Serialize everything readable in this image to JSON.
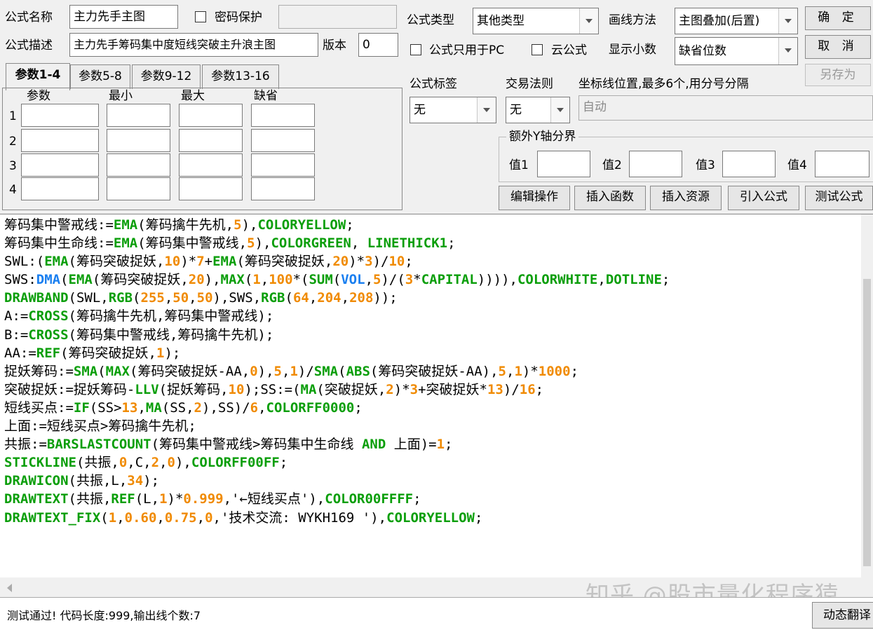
{
  "form": {
    "name_label": "公式名称",
    "name_value": "主力先手主图",
    "password_label": "密码保护",
    "desc_label": "公式描述",
    "desc_value": "主力先手筹码集中度短线突破主升浪主图",
    "version_label": "版本",
    "version_value": "0",
    "type_label": "公式类型",
    "type_value": "其他类型",
    "draw_method_label": "画线方法",
    "draw_method_value": "主图叠加(后置)",
    "pc_only_label": "公式只用于PC",
    "cloud_label": "云公式",
    "decimals_label": "显示小数",
    "decimals_value": "缺省位数",
    "tag_label": "公式标签",
    "tag_value": "无",
    "trade_rule_label": "交易法则",
    "trade_rule_value": "无",
    "axis_label": "坐标线位置,最多6个,用分号分隔",
    "axis_value": "自动",
    "extra_y_label": "额外Y轴分界",
    "y_values": [
      "值1",
      "值2",
      "值3",
      "值4"
    ]
  },
  "buttons": {
    "ok": "确 定",
    "cancel": "取 消",
    "save_as": "另存为",
    "edit_ops": "编辑操作",
    "insert_func": "插入函数",
    "insert_res": "插入资源",
    "import_formula": "引入公式",
    "test_formula": "测试公式",
    "translate": "动态翻译"
  },
  "tabs": [
    "参数1-4",
    "参数5-8",
    "参数9-12",
    "参数13-16"
  ],
  "params": {
    "headers": [
      "参数",
      "最小",
      "最大",
      "缺省"
    ],
    "rows": [
      "1",
      "2",
      "3",
      "4"
    ]
  },
  "code_colors": {
    "func": "#0a9e0a",
    "num": "#f08a00",
    "blue": "#1a7ff0",
    "text": "#000000"
  },
  "code": [
    [
      [
        "筹码集中警戒线:=",
        "t"
      ],
      [
        "EMA",
        "f"
      ],
      [
        "(筹码擒牛先机,",
        "t"
      ],
      [
        "5",
        "n"
      ],
      [
        "),",
        "t"
      ],
      [
        "COLORYELLOW",
        "f"
      ],
      [
        ";",
        "t"
      ]
    ],
    [
      [
        "筹码集中生命线:=",
        "t"
      ],
      [
        "EMA",
        "f"
      ],
      [
        "(筹码集中警戒线,",
        "t"
      ],
      [
        "5",
        "n"
      ],
      [
        "),",
        "t"
      ],
      [
        "COLORGREEN",
        "f"
      ],
      [
        ", ",
        "t"
      ],
      [
        "LINETHICK1",
        "f"
      ],
      [
        ";",
        "t"
      ]
    ],
    [
      [
        "SWL:(",
        "t"
      ],
      [
        "EMA",
        "f"
      ],
      [
        "(筹码突破捉妖,",
        "t"
      ],
      [
        "10",
        "n"
      ],
      [
        ")*",
        "t"
      ],
      [
        "7",
        "n"
      ],
      [
        "+",
        "t"
      ],
      [
        "EMA",
        "f"
      ],
      [
        "(筹码突破捉妖,",
        "t"
      ],
      [
        "20",
        "n"
      ],
      [
        ")*",
        "t"
      ],
      [
        "3",
        "n"
      ],
      [
        ")/",
        "t"
      ],
      [
        "10",
        "n"
      ],
      [
        ";",
        "t"
      ]
    ],
    [
      [
        "SWS:",
        "t"
      ],
      [
        "DMA",
        "b"
      ],
      [
        "(",
        "t"
      ],
      [
        "EMA",
        "f"
      ],
      [
        "(筹码突破捉妖,",
        "t"
      ],
      [
        "20",
        "n"
      ],
      [
        "),",
        "t"
      ],
      [
        "MAX",
        "f"
      ],
      [
        "(",
        "t"
      ],
      [
        "1",
        "n"
      ],
      [
        ",",
        "t"
      ],
      [
        "100",
        "n"
      ],
      [
        "*(",
        "t"
      ],
      [
        "SUM",
        "f"
      ],
      [
        "(",
        "t"
      ],
      [
        "VOL",
        "b"
      ],
      [
        ",",
        "t"
      ],
      [
        "5",
        "n"
      ],
      [
        ")/(",
        "t"
      ],
      [
        "3",
        "n"
      ],
      [
        "*",
        "t"
      ],
      [
        "CAPITAL",
        "f"
      ],
      [
        ")))),",
        "t"
      ],
      [
        "COLORWHITE",
        "f"
      ],
      [
        ",",
        "t"
      ],
      [
        "DOTLINE",
        "f"
      ],
      [
        ";",
        "t"
      ]
    ],
    [
      [
        "DRAWBAND",
        "f"
      ],
      [
        "(SWL,",
        "t"
      ],
      [
        "RGB",
        "f"
      ],
      [
        "(",
        "t"
      ],
      [
        "255",
        "n"
      ],
      [
        ",",
        "t"
      ],
      [
        "50",
        "n"
      ],
      [
        ",",
        "t"
      ],
      [
        "50",
        "n"
      ],
      [
        "),SWS,",
        "t"
      ],
      [
        "RGB",
        "f"
      ],
      [
        "(",
        "t"
      ],
      [
        "64",
        "n"
      ],
      [
        ",",
        "t"
      ],
      [
        "204",
        "n"
      ],
      [
        ",",
        "t"
      ],
      [
        "208",
        "n"
      ],
      [
        "));",
        "t"
      ]
    ],
    [
      [
        "A:=",
        "t"
      ],
      [
        "CROSS",
        "f"
      ],
      [
        "(筹码擒牛先机,筹码集中警戒线);",
        "t"
      ]
    ],
    [
      [
        "B:=",
        "t"
      ],
      [
        "CROSS",
        "f"
      ],
      [
        "(筹码集中警戒线,筹码擒牛先机);",
        "t"
      ]
    ],
    [
      [
        "AA:=",
        "t"
      ],
      [
        "REF",
        "f"
      ],
      [
        "(筹码突破捉妖,",
        "t"
      ],
      [
        "1",
        "n"
      ],
      [
        ");",
        "t"
      ]
    ],
    [
      [
        "捉妖筹码:=",
        "t"
      ],
      [
        "SMA",
        "f"
      ],
      [
        "(",
        "t"
      ],
      [
        "MAX",
        "f"
      ],
      [
        "(筹码突破捉妖-AA,",
        "t"
      ],
      [
        "0",
        "n"
      ],
      [
        "),",
        "t"
      ],
      [
        "5",
        "n"
      ],
      [
        ",",
        "t"
      ],
      [
        "1",
        "n"
      ],
      [
        ")/",
        "t"
      ],
      [
        "SMA",
        "f"
      ],
      [
        "(",
        "t"
      ],
      [
        "ABS",
        "f"
      ],
      [
        "(筹码突破捉妖-AA),",
        "t"
      ],
      [
        "5",
        "n"
      ],
      [
        ",",
        "t"
      ],
      [
        "1",
        "n"
      ],
      [
        ")*",
        "t"
      ],
      [
        "1000",
        "n"
      ],
      [
        ";",
        "t"
      ]
    ],
    [
      [
        "突破捉妖:=捉妖筹码-",
        "t"
      ],
      [
        "LLV",
        "f"
      ],
      [
        "(捉妖筹码,",
        "t"
      ],
      [
        "10",
        "n"
      ],
      [
        ");SS:=(",
        "t"
      ],
      [
        "MA",
        "f"
      ],
      [
        "(突破捉妖,",
        "t"
      ],
      [
        "2",
        "n"
      ],
      [
        ")*",
        "t"
      ],
      [
        "3",
        "n"
      ],
      [
        "+突破捉妖*",
        "t"
      ],
      [
        "13",
        "n"
      ],
      [
        ")/",
        "t"
      ],
      [
        "16",
        "n"
      ],
      [
        ";",
        "t"
      ]
    ],
    [
      [
        "短线买点:=",
        "t"
      ],
      [
        "IF",
        "f"
      ],
      [
        "(SS>",
        "t"
      ],
      [
        "13",
        "n"
      ],
      [
        ",",
        "t"
      ],
      [
        "MA",
        "f"
      ],
      [
        "(SS,",
        "t"
      ],
      [
        "2",
        "n"
      ],
      [
        "),SS)/",
        "t"
      ],
      [
        "6",
        "n"
      ],
      [
        ",",
        "t"
      ],
      [
        "COLORFF0000",
        "f"
      ],
      [
        ";",
        "t"
      ]
    ],
    [
      [
        "上面:=短线买点>筹码擒牛先机;",
        "t"
      ]
    ],
    [
      [
        "共振:=",
        "t"
      ],
      [
        "BARSLASTCOUNT",
        "f"
      ],
      [
        "(筹码集中警戒线>筹码集中生命线 ",
        "t"
      ],
      [
        "AND",
        "f"
      ],
      [
        " 上面)=",
        "t"
      ],
      [
        "1",
        "n"
      ],
      [
        ";",
        "t"
      ]
    ],
    [
      [
        "STICKLINE",
        "f"
      ],
      [
        "(共振,",
        "t"
      ],
      [
        "0",
        "n"
      ],
      [
        ",C,",
        "t"
      ],
      [
        "2",
        "n"
      ],
      [
        ",",
        "t"
      ],
      [
        "0",
        "n"
      ],
      [
        "),",
        "t"
      ],
      [
        "COLORFF00FF",
        "f"
      ],
      [
        ";",
        "t"
      ]
    ],
    [
      [
        "DRAWICON",
        "f"
      ],
      [
        "(共振,L,",
        "t"
      ],
      [
        "34",
        "n"
      ],
      [
        ");",
        "t"
      ]
    ],
    [
      [
        "DRAWTEXT",
        "f"
      ],
      [
        "(共振,",
        "t"
      ],
      [
        "REF",
        "f"
      ],
      [
        "(L,",
        "t"
      ],
      [
        "1",
        "n"
      ],
      [
        ")*",
        "t"
      ],
      [
        "0.999",
        "n"
      ],
      [
        ",'←短线买点'),",
        "t"
      ],
      [
        "COLOR00FFFF",
        "f"
      ],
      [
        ";",
        "t"
      ]
    ],
    [
      [
        "DRAWTEXT_FIX",
        "f"
      ],
      [
        "(",
        "t"
      ],
      [
        "1",
        "n"
      ],
      [
        ",",
        "t"
      ],
      [
        "0.60",
        "n"
      ],
      [
        ",",
        "t"
      ],
      [
        "0.75",
        "n"
      ],
      [
        ",",
        "t"
      ],
      [
        "0",
        "n"
      ],
      [
        ",'技术交流: WYKH169 '),",
        "t"
      ],
      [
        "COLORYELLOW",
        "f"
      ],
      [
        ";",
        "t"
      ]
    ]
  ],
  "status": "测试通过! 代码长度:999,输出线个数:7",
  "watermark": "知乎 @股市量化程序猿"
}
